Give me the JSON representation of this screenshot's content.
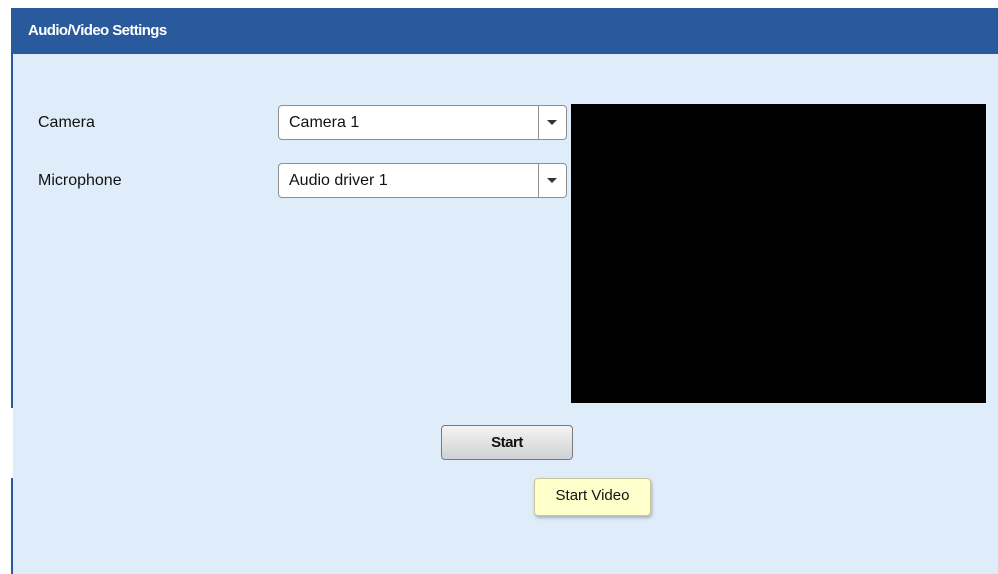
{
  "window": {
    "title": "Audio/Video Settings"
  },
  "fields": {
    "camera": {
      "label": "Camera",
      "value": "Camera 1"
    },
    "microphone": {
      "label": "Microphone",
      "value": "Audio driver 1"
    }
  },
  "actions": {
    "start_label": "Start"
  },
  "tooltip": {
    "text": "Start Video"
  },
  "icons": {
    "dropdown": "chevron-down-icon"
  },
  "colors": {
    "title_bar": "#2a5a9e",
    "panel_background": "#dfecfa",
    "video_preview": "#000000",
    "tooltip_background": "#ffffcc"
  }
}
